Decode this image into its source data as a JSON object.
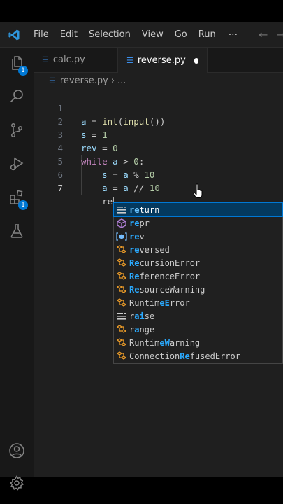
{
  "menu": {
    "items": [
      "File",
      "Edit",
      "Selection",
      "View",
      "Go",
      "Run"
    ],
    "more": "···"
  },
  "tabs": [
    {
      "label": "calc.py"
    },
    {
      "label": "reverse.py"
    }
  ],
  "breadcrumb": {
    "file": "reverse.py",
    "more": "..."
  },
  "activity": {
    "explorer_badge": "1",
    "extensions_badge": "1"
  },
  "editor": {
    "lines": [
      {
        "num": "1"
      },
      {
        "num": "2"
      },
      {
        "num": "3"
      },
      {
        "num": "4"
      },
      {
        "num": "5"
      },
      {
        "num": "6"
      },
      {
        "num": "7"
      }
    ],
    "typed": "re"
  },
  "suggestions": [
    {
      "match": "re",
      "rest": "turn",
      "icon": "keyword-icon"
    },
    {
      "match": "re",
      "rest": "pr",
      "icon": "function-icon"
    },
    {
      "match": "re",
      "rest": "v",
      "icon": "variable-icon"
    },
    {
      "match": "re",
      "rest": "versed",
      "icon": "class-icon"
    },
    {
      "pre": "",
      "match": "Re",
      "rest": "cursionError",
      "icon": "class-icon"
    },
    {
      "match": "Re",
      "rest": "ferenceError",
      "icon": "class-icon"
    },
    {
      "match": "Re",
      "rest": "sourceWarning",
      "icon": "class-icon"
    },
    {
      "pre": "Runtim",
      "match": "eE",
      "rest": "rror",
      "icon": "class-icon"
    },
    {
      "pre": "r",
      "match": "ai",
      "rest": "se",
      "icon": "keyword-icon"
    },
    {
      "pre": "r",
      "match": "a",
      "rest": "nge",
      "icon": "class-icon"
    },
    {
      "pre": "Runtim",
      "match": "eW",
      "rest": "arning",
      "icon": "class-icon"
    },
    {
      "pre": "Connection",
      "match": "Re",
      "rest": "fusedError",
      "icon": "class-icon"
    }
  ],
  "colors": {
    "accent": "#0078d4",
    "keyword": "#c586c0",
    "variable": "#9cdcfe",
    "function": "#dcdcaa",
    "number": "#b5cea8",
    "match": "#2aaaff"
  }
}
